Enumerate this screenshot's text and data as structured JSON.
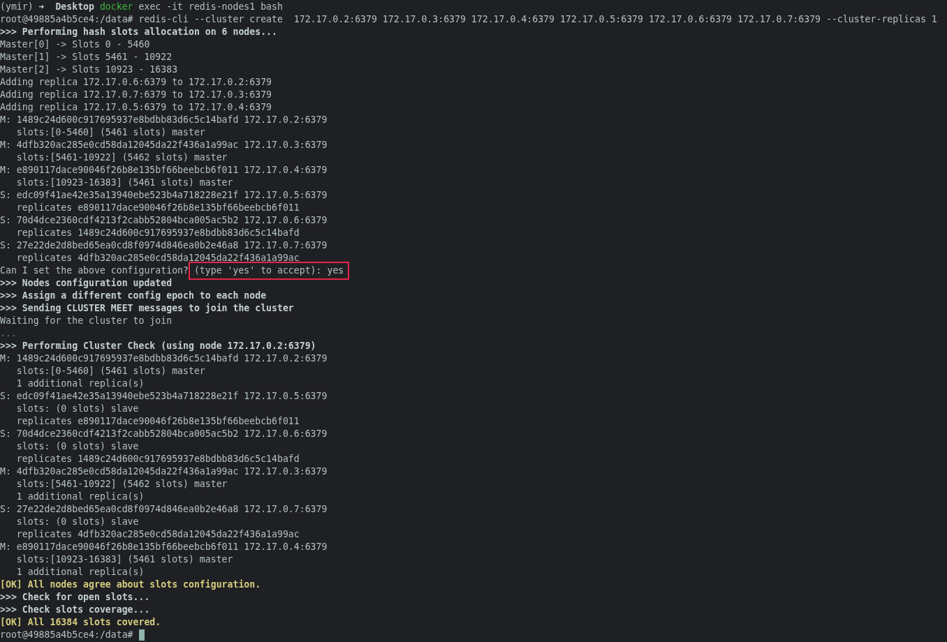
{
  "terminal": {
    "lines": [
      {
        "segments": [
          {
            "text": "(ymir) ",
            "kind": "plain"
          },
          {
            "text": "➜  Desktop ",
            "kind": "bold"
          },
          {
            "text": "docker",
            "kind": "command"
          },
          {
            "text": " exec -it redis-nodes1 bash",
            "kind": "plain"
          }
        ]
      },
      {
        "segments": [
          {
            "text": "root@49885a4b5ce4:/data# redis-cli --cluster create  172.17.0.2:6379 172.17.0.3:6379 172.17.0.4:6379 172.17.0.5:6379 172.17.0.6:6379 172.17.0.7:6379 --cluster-replicas 1",
            "kind": "plain"
          }
        ]
      },
      {
        "segments": [
          {
            "text": ">>> Performing hash slots allocation on 6 nodes...",
            "kind": "bold"
          }
        ]
      },
      {
        "segments": [
          {
            "text": "Master[0] -> Slots 0 - 5460",
            "kind": "plain"
          }
        ]
      },
      {
        "segments": [
          {
            "text": "Master[1] -> Slots 5461 - 10922",
            "kind": "plain"
          }
        ]
      },
      {
        "segments": [
          {
            "text": "Master[2] -> Slots 10923 - 16383",
            "kind": "plain"
          }
        ]
      },
      {
        "segments": [
          {
            "text": "Adding replica 172.17.0.6:6379 to 172.17.0.2:6379",
            "kind": "plain"
          }
        ]
      },
      {
        "segments": [
          {
            "text": "Adding replica 172.17.0.7:6379 to 172.17.0.3:6379",
            "kind": "plain"
          }
        ]
      },
      {
        "segments": [
          {
            "text": "Adding replica 172.17.0.5:6379 to 172.17.0.4:6379",
            "kind": "plain"
          }
        ]
      },
      {
        "segments": [
          {
            "text": "M: 1489c24d600c917695937e8bdbb83d6c5c14bafd 172.17.0.2:6379",
            "kind": "plain"
          }
        ]
      },
      {
        "segments": [
          {
            "text": "   slots:[0-5460] (5461 slots) master",
            "kind": "plain"
          }
        ]
      },
      {
        "segments": [
          {
            "text": "M: 4dfb320ac285e0cd58da12045da22f436a1a99ac 172.17.0.3:6379",
            "kind": "plain"
          }
        ]
      },
      {
        "segments": [
          {
            "text": "   slots:[5461-10922] (5462 slots) master",
            "kind": "plain"
          }
        ]
      },
      {
        "segments": [
          {
            "text": "M: e890117dace90046f26b8e135bf66beebcb6f011 172.17.0.4:6379",
            "kind": "plain"
          }
        ]
      },
      {
        "segments": [
          {
            "text": "   slots:[10923-16383] (5461 slots) master",
            "kind": "plain"
          }
        ]
      },
      {
        "segments": [
          {
            "text": "S: edc09f41ae42e35a13940ebe523b4a718228e21f 172.17.0.5:6379",
            "kind": "plain"
          }
        ]
      },
      {
        "segments": [
          {
            "text": "   replicates e890117dace90046f26b8e135bf66beebcb6f011",
            "kind": "plain"
          }
        ]
      },
      {
        "segments": [
          {
            "text": "S: 70d4dce2360cdf4213f2cabb52804bca005ac5b2 172.17.0.6:6379",
            "kind": "plain"
          }
        ]
      },
      {
        "segments": [
          {
            "text": "   replicates 1489c24d600c917695937e8bdbb83d6c5c14bafd",
            "kind": "plain"
          }
        ]
      },
      {
        "segments": [
          {
            "text": "S: 27e22de2d8bed65ea0cd8f0974d846ea0b2e46a8 172.17.0.7:6379",
            "kind": "plain"
          }
        ]
      },
      {
        "segments": [
          {
            "text": "   replicates 4dfb320ac285e0cd58da12045da22f436a1a99ac",
            "kind": "plain"
          }
        ]
      },
      {
        "segments": [
          {
            "text": "Can I set the above configuration? ",
            "kind": "plain"
          },
          {
            "text": "(type 'yes' to accept): yes",
            "kind": "plain",
            "boxed": true
          }
        ]
      },
      {
        "segments": [
          {
            "text": ">>> Nodes configuration updated",
            "kind": "bold"
          }
        ]
      },
      {
        "segments": [
          {
            "text": ">>> Assign a different config epoch to each node",
            "kind": "bold"
          }
        ]
      },
      {
        "segments": [
          {
            "text": ">>> Sending CLUSTER MEET messages to join the cluster",
            "kind": "bold"
          }
        ]
      },
      {
        "segments": [
          {
            "text": "Waiting for the cluster to join",
            "kind": "plain"
          }
        ]
      },
      {
        "segments": [
          {
            "text": "...",
            "kind": "dim"
          }
        ]
      },
      {
        "segments": [
          {
            "text": ">>> Performing Cluster Check (using node 172.17.0.2:6379)",
            "kind": "bold"
          }
        ]
      },
      {
        "segments": [
          {
            "text": "M: 1489c24d600c917695937e8bdbb83d6c5c14bafd 172.17.0.2:6379",
            "kind": "plain"
          }
        ]
      },
      {
        "segments": [
          {
            "text": "   slots:[0-5460] (5461 slots) master",
            "kind": "plain"
          }
        ]
      },
      {
        "segments": [
          {
            "text": "   1 additional replica(s)",
            "kind": "plain"
          }
        ]
      },
      {
        "segments": [
          {
            "text": "S: edc09f41ae42e35a13940ebe523b4a718228e21f 172.17.0.5:6379",
            "kind": "plain"
          }
        ]
      },
      {
        "segments": [
          {
            "text": "   slots: (0 slots) slave",
            "kind": "plain"
          }
        ]
      },
      {
        "segments": [
          {
            "text": "   replicates e890117dace90046f26b8e135bf66beebcb6f011",
            "kind": "plain"
          }
        ]
      },
      {
        "segments": [
          {
            "text": "S: 70d4dce2360cdf4213f2cabb52804bca005ac5b2 172.17.0.6:6379",
            "kind": "plain"
          }
        ]
      },
      {
        "segments": [
          {
            "text": "   slots: (0 slots) slave",
            "kind": "plain"
          }
        ]
      },
      {
        "segments": [
          {
            "text": "   replicates 1489c24d600c917695937e8bdbb83d6c5c14bafd",
            "kind": "plain"
          }
        ]
      },
      {
        "segments": [
          {
            "text": "M: 4dfb320ac285e0cd58da12045da22f436a1a99ac 172.17.0.3:6379",
            "kind": "plain"
          }
        ]
      },
      {
        "segments": [
          {
            "text": "   slots:[5461-10922] (5462 slots) master",
            "kind": "plain"
          }
        ]
      },
      {
        "segments": [
          {
            "text": "   1 additional replica(s)",
            "kind": "plain"
          }
        ]
      },
      {
        "segments": [
          {
            "text": "S: 27e22de2d8bed65ea0cd8f0974d846ea0b2e46a8 172.17.0.7:6379",
            "kind": "plain"
          }
        ]
      },
      {
        "segments": [
          {
            "text": "   slots: (0 slots) slave",
            "kind": "plain"
          }
        ]
      },
      {
        "segments": [
          {
            "text": "   replicates 4dfb320ac285e0cd58da12045da22f436a1a99ac",
            "kind": "plain"
          }
        ]
      },
      {
        "segments": [
          {
            "text": "M: e890117dace90046f26b8e135bf66beebcb6f011 172.17.0.4:6379",
            "kind": "plain"
          }
        ]
      },
      {
        "segments": [
          {
            "text": "   slots:[10923-16383] (5461 slots) master",
            "kind": "plain"
          }
        ]
      },
      {
        "segments": [
          {
            "text": "   1 additional replica(s)",
            "kind": "plain"
          }
        ]
      },
      {
        "segments": [
          {
            "text": "[OK] All nodes agree about slots configuration.",
            "kind": "ok"
          }
        ]
      },
      {
        "segments": [
          {
            "text": ">>> Check for open slots...",
            "kind": "bold"
          }
        ]
      },
      {
        "segments": [
          {
            "text": ">>> Check slots coverage...",
            "kind": "bold"
          }
        ]
      },
      {
        "segments": [
          {
            "text": "[OK] All 16384 slots covered.",
            "kind": "ok"
          }
        ]
      },
      {
        "segments": [
          {
            "text": "root@49885a4b5ce4:/data# ",
            "kind": "plain"
          }
        ],
        "cursor": true
      }
    ]
  }
}
